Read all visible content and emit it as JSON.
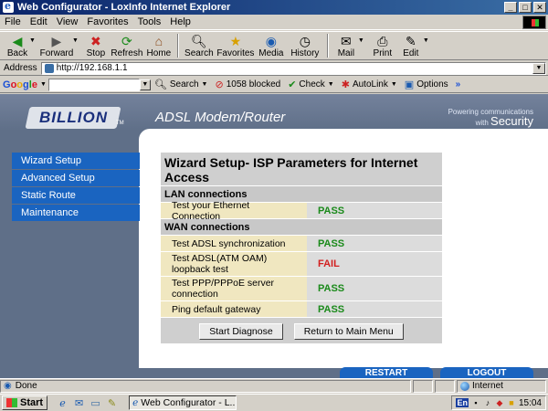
{
  "window": {
    "title": "Web Configurator - LoxInfo Internet Explorer",
    "controls": {
      "minimize": "_",
      "maximize": "□",
      "close": "✕"
    }
  },
  "menu": {
    "items": [
      {
        "label": "File"
      },
      {
        "label": "Edit"
      },
      {
        "label": "View"
      },
      {
        "label": "Favorites"
      },
      {
        "label": "Tools"
      },
      {
        "label": "Help"
      }
    ]
  },
  "toolbar": {
    "back": "Back",
    "forward": "Forward",
    "stop": "Stop",
    "refresh": "Refresh",
    "home": "Home",
    "search": "Search",
    "favorites": "Favorites",
    "media": "Media",
    "history": "History",
    "mail": "Mail",
    "print": "Print",
    "edit": "Edit"
  },
  "address": {
    "label": "Address",
    "url": "http://192.168.1.1"
  },
  "google_bar": {
    "search_label": "Search",
    "blocked": "1058 blocked",
    "check": "Check",
    "autolink": "AutoLink",
    "options": "Options",
    "more": "»"
  },
  "banner": {
    "brand": "BILLION",
    "tm": "TM",
    "product": "ADSL Modem/Router",
    "powering_line1": "Powering",
    "powering_line2": "communications",
    "powering_with": "with",
    "security": "Security"
  },
  "nav": {
    "items": [
      {
        "label": "Wizard Setup"
      },
      {
        "label": "Advanced Setup"
      },
      {
        "label": "Static Route"
      },
      {
        "label": "Maintenance"
      }
    ]
  },
  "wizard": {
    "title": "Wizard Setup- ISP Parameters for Internet Access",
    "lan_section": "LAN connections",
    "lan_rows": [
      {
        "label": "Test your Ethernet Connection",
        "result": "PASS"
      }
    ],
    "wan_section": "WAN connections",
    "wan_rows": [
      {
        "label": "Test ADSL synchronization",
        "result": "PASS"
      },
      {
        "label": "Test ADSL(ATM OAM) loopback test",
        "result": "FAIL"
      },
      {
        "label": "Test PPP/PPPoE server connection",
        "result": "PASS"
      },
      {
        "label": "Ping default gateway",
        "result": "PASS"
      }
    ],
    "start_button": "Start Diagnose",
    "return_button": "Return to Main Menu"
  },
  "bottom_tabs": {
    "restart": "RESTART",
    "logout": "LOGOUT"
  },
  "status": {
    "text": "Done",
    "zone": "Internet"
  },
  "taskbar": {
    "start": "Start",
    "task": "Web Configurator - L...",
    "lang": "En",
    "time": "15:04"
  },
  "colors": {
    "pass": "#1a8a1a",
    "fail": "#d21f1f",
    "nav_blue": "#1a64c0",
    "title_bar": "#0a246a"
  }
}
